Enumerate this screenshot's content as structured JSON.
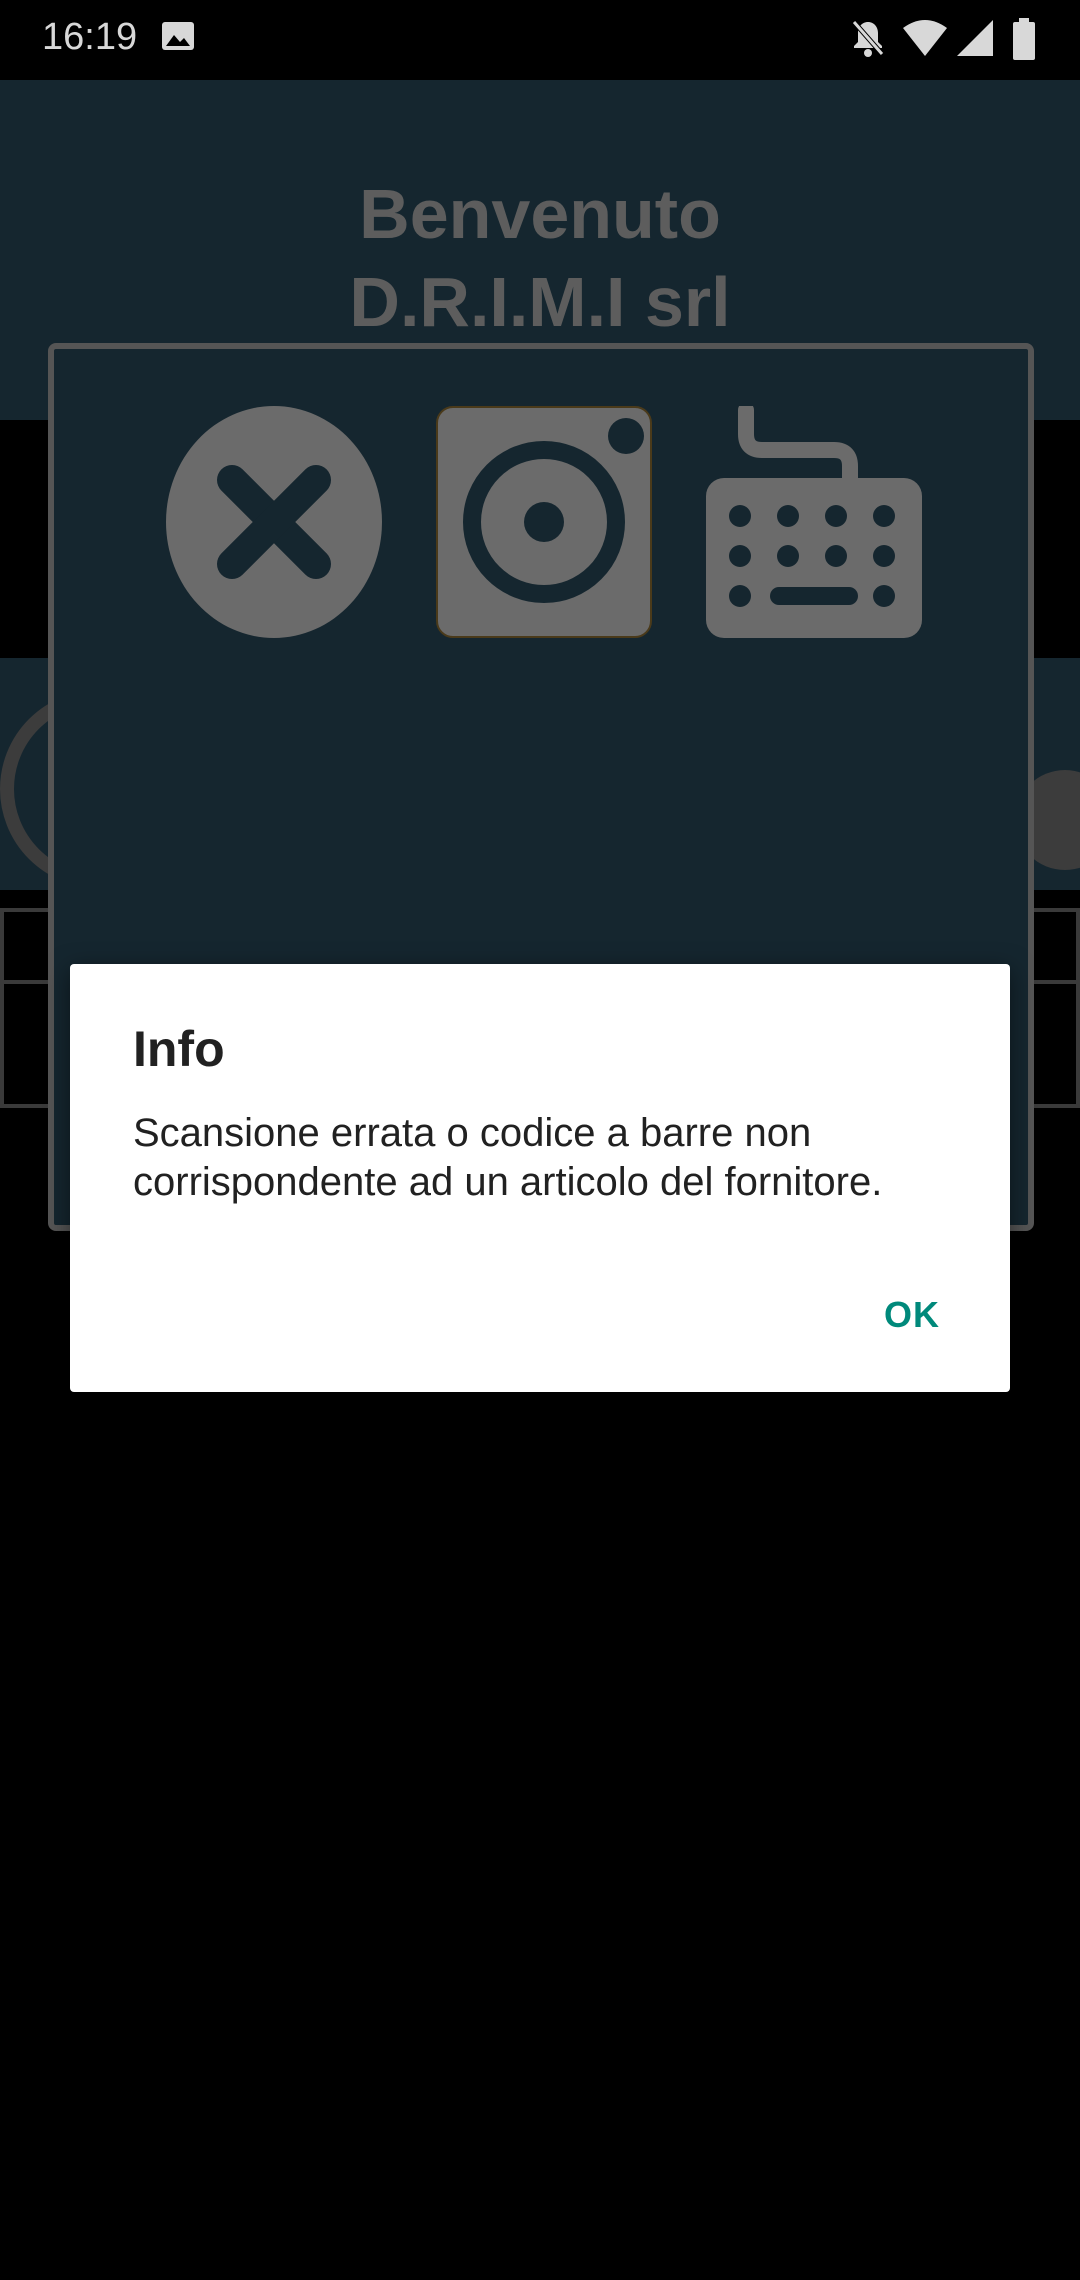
{
  "status_bar": {
    "time": "16:19",
    "icons": [
      "image-icon",
      "bell-muted-icon",
      "wifi-icon",
      "signal-icon",
      "battery-icon"
    ]
  },
  "app": {
    "welcome_line": "Benvenuto",
    "company_line": "D.R.I.M.I srl"
  },
  "scan_panel": {
    "buttons": [
      "cancel-icon",
      "camera-icon",
      "keyboard-icon"
    ]
  },
  "alert": {
    "title": "Info",
    "message": "Scansione errata o codice a barre non corrispondente ad un articolo del fornitore.",
    "ok_label": "OK"
  },
  "colors": {
    "panel_bg": "#15262f",
    "icon_gray": "#6b6b6b",
    "accent": "#00897b"
  }
}
